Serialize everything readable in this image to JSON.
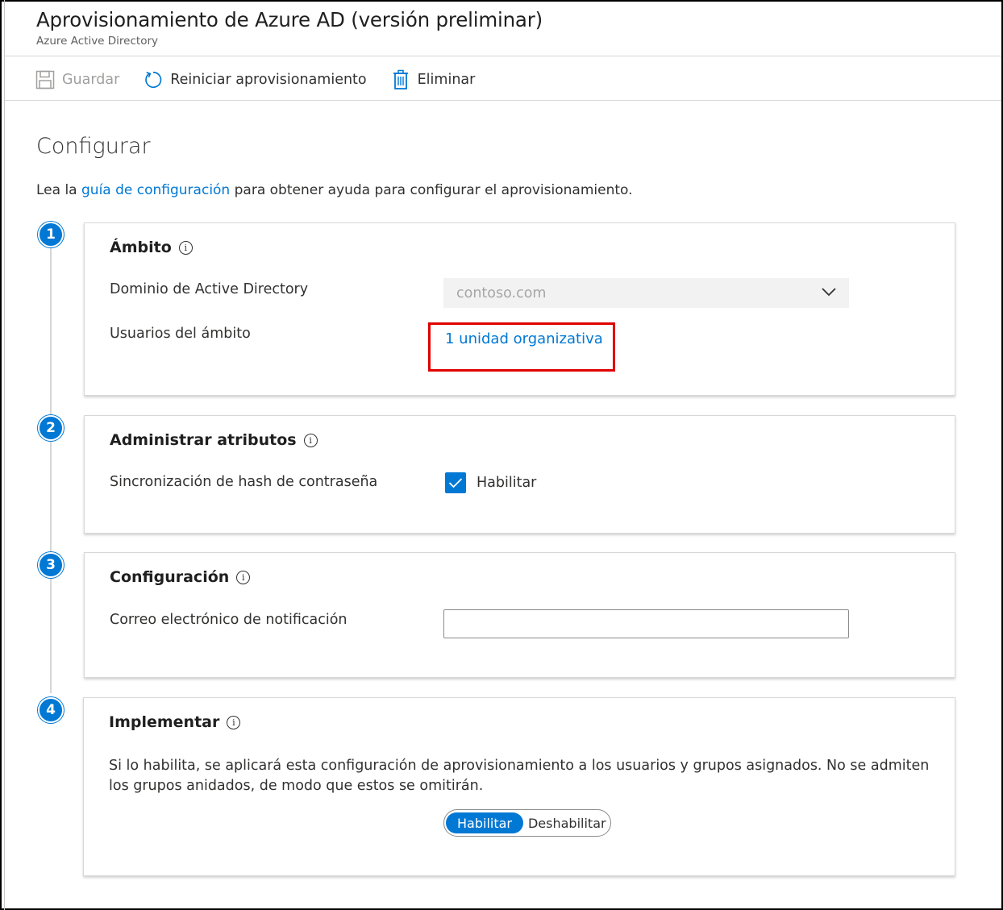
{
  "blade": {
    "title": "Aprovisionamiento de Azure AD (versión preliminar)",
    "subtitle": "Azure Active Directory"
  },
  "toolbar": {
    "save_label": "Guardar",
    "restart_label": "Reiniciar aprovisionamiento",
    "delete_label": "Eliminar"
  },
  "main": {
    "title": "Configurar",
    "intro_prefix": "Lea la ",
    "intro_link": "guía de configuración",
    "intro_suffix": " para obtener ayuda para configurar el aprovisionamiento."
  },
  "steps": [
    {
      "number": "1",
      "title": "Ámbito",
      "domain_label": "Dominio de Active Directory",
      "domain_value": "contoso.com",
      "users_label": "Usuarios del ámbito",
      "users_link": "1 unidad organizativa"
    },
    {
      "number": "2",
      "title": "Administrar atributos",
      "hash_label": "Sincronización de hash de contraseña",
      "hash_checkbox_label": "Habilitar",
      "hash_checked": true
    },
    {
      "number": "3",
      "title": "Configuración",
      "email_label": "Correo electrónico de notificación",
      "email_value": ""
    },
    {
      "number": "4",
      "title": "Implementar",
      "description": "Si lo habilita, se aplicará esta configuración de aprovisionamiento a los usuarios y grupos asignados. No se admiten los grupos anidados, de modo que estos se omitirán.",
      "toggle_on": "Habilitar",
      "toggle_off": "Deshabilitar",
      "toggle_selected": "Habilitar"
    }
  ],
  "colors": {
    "accent": "#0078d4",
    "highlight": "#e00000"
  }
}
